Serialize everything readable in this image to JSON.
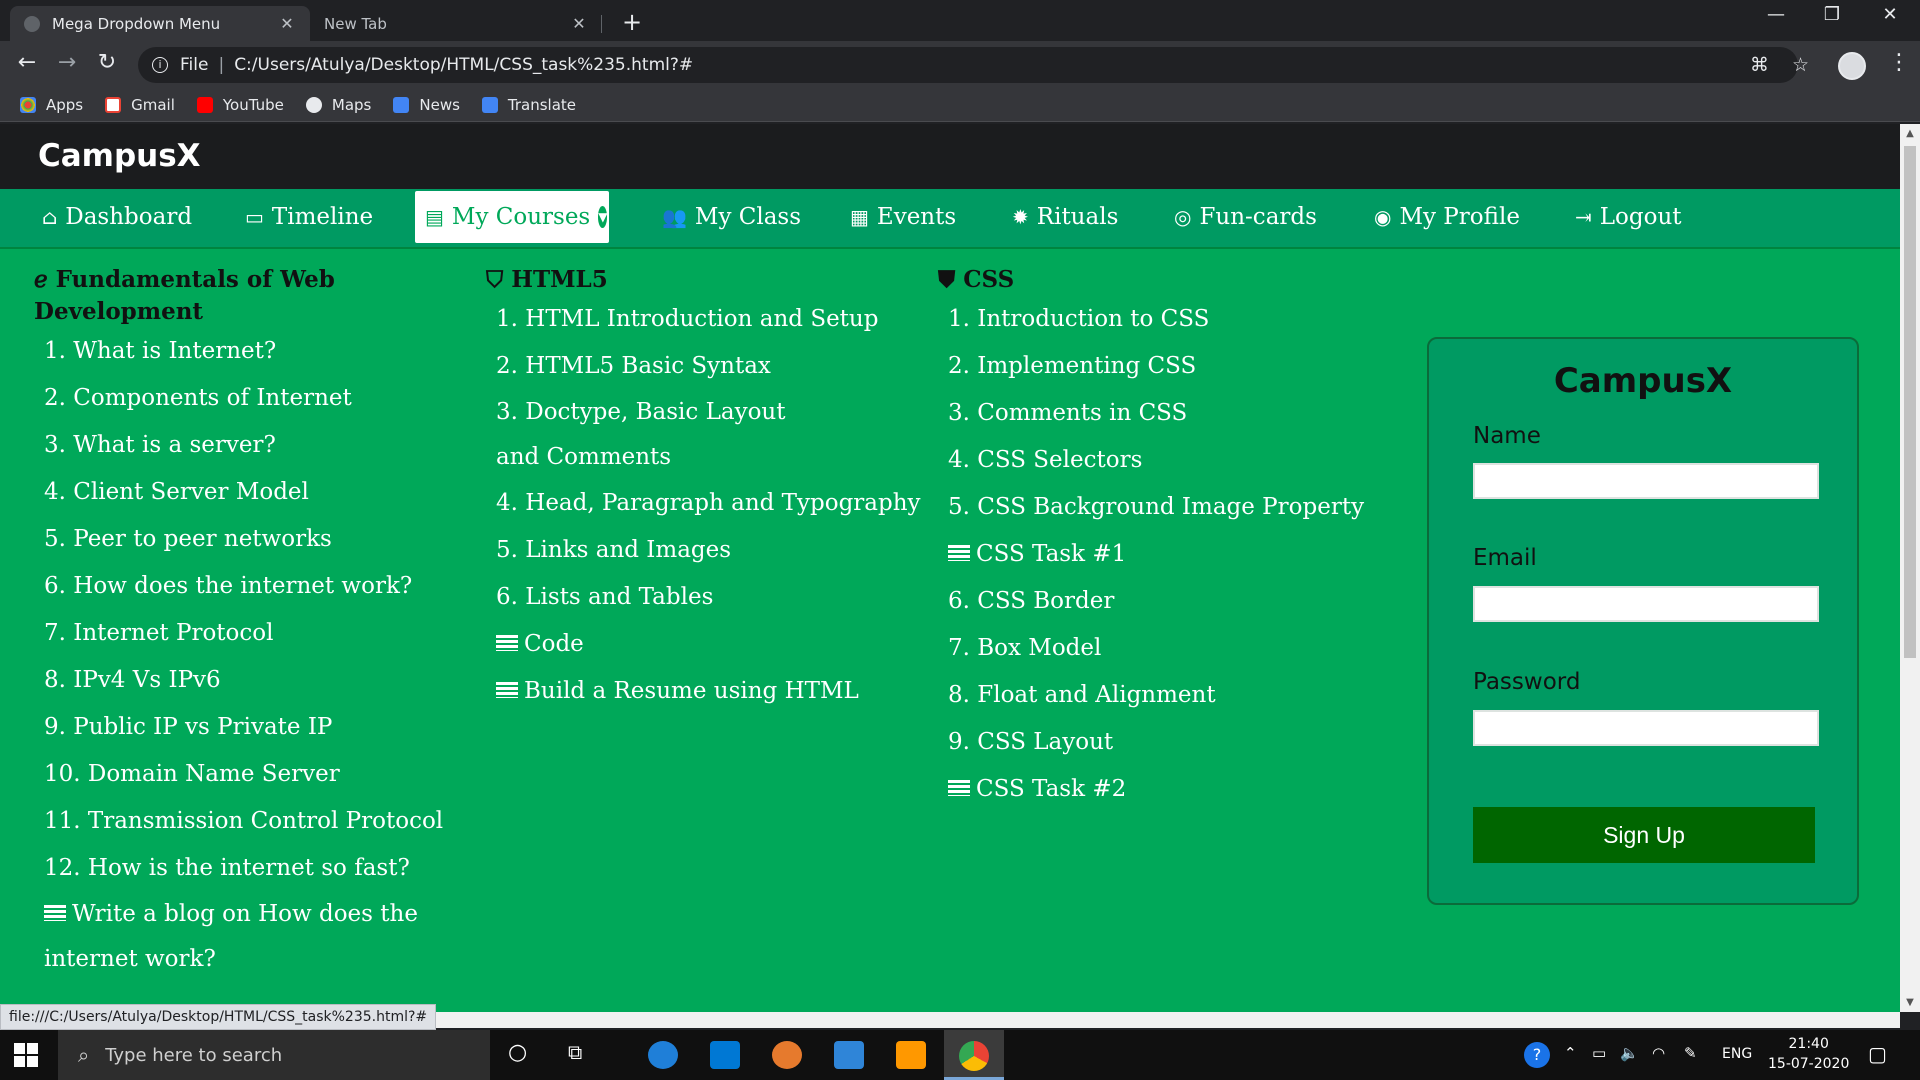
{
  "browser": {
    "tabs": [
      {
        "title": "Mega Dropdown Menu",
        "active": true
      },
      {
        "title": "New Tab",
        "active": false
      }
    ],
    "omnibox": {
      "scheme": "File",
      "url": "C:/Users/Atulya/Desktop/HTML/CSS_task%235.html?#"
    },
    "bookmarks": [
      "Apps",
      "Gmail",
      "YouTube",
      "Maps",
      "News",
      "Translate"
    ],
    "status_url": "file:///C:/Users/Atulya/Desktop/HTML/CSS_task%235.html?#"
  },
  "page": {
    "brand": "CampusX",
    "menu": [
      {
        "label": "Dashboard",
        "icon": "home-icon",
        "glyph": "⌂"
      },
      {
        "label": "Timeline",
        "icon": "window-icon",
        "glyph": "▭"
      },
      {
        "label": "My Courses",
        "icon": "book-icon",
        "glyph": "▤",
        "active": true
      },
      {
        "label": "My Class",
        "icon": "users-icon",
        "glyph": "👥"
      },
      {
        "label": "Events",
        "icon": "calendar-icon",
        "glyph": "▦"
      },
      {
        "label": "Rituals",
        "icon": "gear-icon",
        "glyph": "✹"
      },
      {
        "label": "Fun-cards",
        "icon": "gamepad-icon",
        "glyph": "◎"
      },
      {
        "label": "My Profile",
        "icon": "user-circle-icon",
        "glyph": "◉"
      },
      {
        "label": "Logout",
        "icon": "logout-icon",
        "glyph": "⇥"
      }
    ],
    "columns": [
      {
        "heading": "Fundamentals of Web Development",
        "icon": "edge-icon",
        "items": [
          "1. What is Internet?",
          "2. Components of Internet",
          "3. What is a server?",
          "4. Client Server Model",
          "5. Peer to peer networks",
          "6. How does the internet work?",
          "7. Internet Protocol",
          "8. IPv4 Vs IPv6",
          "9. Public IP vs Private IP",
          "10. Domain Name Server",
          "11. Transmission Control Protocol",
          "12. How is the internet so fast?",
          "Write a blog on How does the internet work?"
        ]
      },
      {
        "heading": "HTML5",
        "icon": "html5-icon",
        "items": [
          "1. HTML Introduction and Setup",
          "2. HTML5 Basic Syntax",
          "3. Doctype, Basic Layout and Comments",
          "4. Head, Paragraph and Typography",
          "5. Links and Images",
          "6. Lists and Tables",
          "Code",
          "Build a Resume using HTML"
        ]
      },
      {
        "heading": "CSS",
        "icon": "css3-icon",
        "items": [
          "1. Introduction to CSS",
          "2. Implementing CSS",
          "3. Comments in CSS",
          "4. CSS Selectors",
          "5. CSS Background Image Property",
          "CSS Task #1",
          "6. CSS Border",
          "7. Box Model",
          "8. Float and Alignment",
          "9. CSS Layout",
          "CSS Task #2"
        ]
      }
    ],
    "form": {
      "title": "CampusX",
      "name_label": "Name",
      "email_label": "Email",
      "password_label": "Password",
      "name_value": "",
      "email_value": "",
      "password_value": "",
      "submit": "Sign Up"
    },
    "colors": {
      "page_bg": "#00a859",
      "menu_bg": "#009a62",
      "brandbar_bg": "#1b1c1e",
      "signup_bg": "#006600"
    }
  },
  "taskbar": {
    "search_placeholder": "Type here to search",
    "language": "ENG",
    "time": "21:40",
    "date": "15-07-2020"
  }
}
